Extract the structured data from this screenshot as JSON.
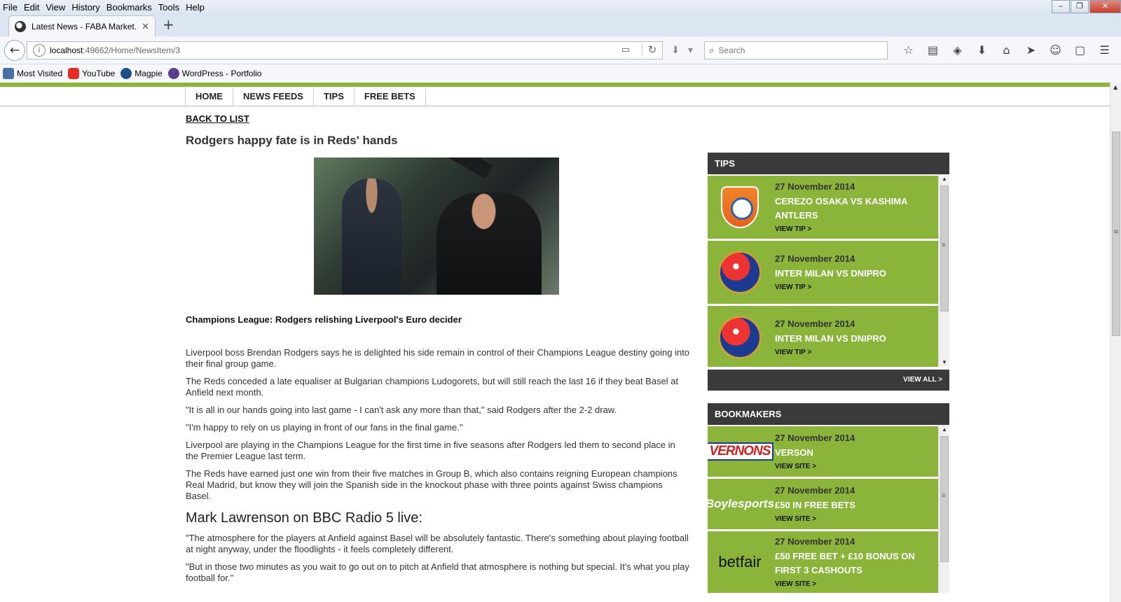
{
  "browser": {
    "menu": [
      "File",
      "Edit",
      "View",
      "History",
      "Bookmarks",
      "Tools",
      "Help"
    ],
    "tab_title": "Latest News - FABA Market...",
    "url_host": "localhost",
    "url_path": ":49662/Home/NewsItem/3",
    "search_placeholder": "Search",
    "bookmarks": [
      "Most Visited",
      "YouTube",
      "Magpie",
      "WordPress - Portfolio"
    ]
  },
  "site": {
    "nav": [
      "HOME",
      "NEWS FEEDS",
      "TIPS",
      "FREE BETS"
    ],
    "back_link": "BACK TO LIST"
  },
  "article": {
    "headline": "Rodgers happy fate is in Reds' hands",
    "subhead": "Champions League: Rodgers relishing Liverpool's Euro decider",
    "paragraphs": [
      "Liverpool boss Brendan Rodgers says he is delighted his side remain in control of their Champions League destiny going into their final group game.",
      "The Reds conceded a late equaliser at Bulgarian champions Ludogorets, but will still reach the last 16 if they beat Basel at Anfield next month.",
      "\"It is all in our hands going into last game - I can't ask any more than that,\" said Rodgers after the 2-2 draw.",
      "\"I'm happy to rely on us playing in front of our fans in the final game.\"",
      "Liverpool are playing in the Champions League for the first time in five seasons after Rodgers led them to second place in the Premier League last term.",
      "The Reds have earned just one win from their five matches in Group B, which also contains reigning European champions Real Madrid, but know they will join the Spanish side in the knockout phase with three points against Swiss champions Basel."
    ],
    "section_heading": "Mark Lawrenson on BBC Radio 5 live:",
    "quotes": [
      "\"The atmosphere for the players at Anfield against Basel will be absolutely fantastic. There's something about playing football at night anyway, under the floodlights - it feels completely different.",
      "\"But in those two minutes as you wait to go out on to pitch at Anfield that atmosphere is nothing but special. It's what you play football for.\""
    ]
  },
  "tips": {
    "heading": "TIPS",
    "view_all": "VIEW ALL >",
    "items": [
      {
        "date": "27 November 2014",
        "title": "CEREZO OSAKA VS KASHIMA ANTLERS",
        "link": "VIEW TIP >",
        "logo": "shimizu-crest-icon"
      },
      {
        "date": "27 November 2014",
        "title": "INTER MILAN VS DNIPRO",
        "link": "VIEW TIP >",
        "logo": "fcb-crest-icon"
      },
      {
        "date": "27 November 2014",
        "title": "INTER MILAN VS DNIPRO",
        "link": "VIEW TIP >",
        "logo": "fcb-crest-icon"
      }
    ]
  },
  "bookmakers": {
    "heading": "BOOKMAKERS",
    "items": [
      {
        "date": "27 November 2014",
        "title": "VERSON",
        "link": "VIEW SITE >",
        "logo_text": "VERNONS"
      },
      {
        "date": "27 November 2014",
        "title": "£50 IN FREE BETS",
        "link": "VIEW SITE >",
        "logo_text": "Boylesports"
      },
      {
        "date": "27 November 2014",
        "title": "£50 FREE BET + £10 BONUS ON FIRST 3 CASHOUTS",
        "link": "VIEW SITE >",
        "logo_text": "betfair"
      }
    ]
  },
  "colors": {
    "accent_green": "#8ab43a",
    "panel_dark": "#3a3a3a"
  }
}
